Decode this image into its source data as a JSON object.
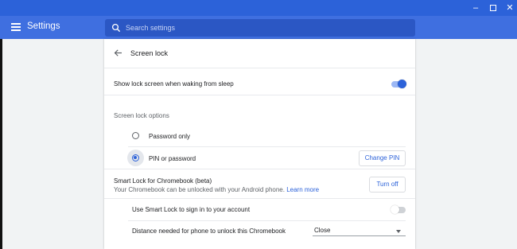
{
  "window": {
    "minimize_glyph": "–",
    "close_glyph": "✕"
  },
  "header": {
    "title": "Settings",
    "search_placeholder": "Search settings"
  },
  "page": {
    "title": "Screen lock",
    "show_lock_screen_label": "Show lock screen when waking from sleep",
    "show_lock_screen_enabled": true,
    "screen_lock_options_heading": "Screen lock options",
    "options": [
      {
        "label": "Password only",
        "selected": false
      },
      {
        "label": "PIN or password",
        "selected": true
      }
    ],
    "change_pin_label": "Change PIN",
    "smart_lock": {
      "title": "Smart Lock for Chromebook (beta)",
      "description": "Your Chromebook can be unlocked with your Android phone.",
      "learn_more": "Learn more",
      "turn_off_label": "Turn off",
      "sign_in_label": "Use Smart Lock to sign in to your account",
      "sign_in_enabled": false,
      "distance_label": "Distance needed for phone to unlock this Chromebook",
      "distance_value": "Close"
    }
  },
  "colors": {
    "titlebar": "#2c62d9",
    "appbar": "#3f6fe0",
    "search_box": "#2b57c4",
    "accent": "#2c62d9",
    "background": "#f1f3f4"
  },
  "icons": {
    "menu": "menu-icon",
    "search": "search-icon",
    "back": "arrow-back-icon",
    "minimize": "minimize-icon",
    "maximize": "maximize-icon",
    "close": "close-icon"
  }
}
